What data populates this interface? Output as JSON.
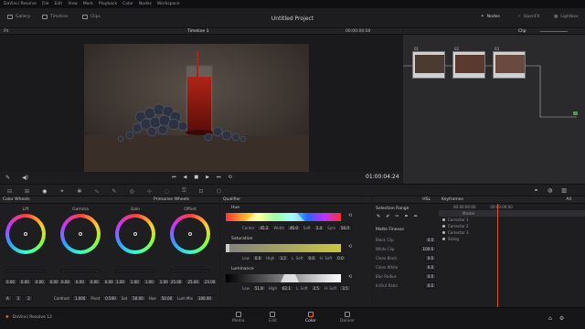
{
  "menu": [
    "DaVinci Resolve",
    "File",
    "Edit",
    "View",
    "Mark",
    "Playback",
    "Color",
    "Nodes",
    "Workspace"
  ],
  "toolbar": {
    "gallery": "Gallery",
    "timeline": "Timeline",
    "clips": "Clips",
    "project_title": "Untitled Project",
    "nodes": "Nodes",
    "openfx": "OpenFX",
    "lightbox": "Lightbox"
  },
  "viewer": {
    "fit": "Fit",
    "timeline_name": "Timeline 1",
    "timecode_top": "00:00:00:00",
    "timecode": "01:00:04:24"
  },
  "node_editor": {
    "mode": "Clip",
    "node_labels": [
      "01",
      "02",
      "03"
    ]
  },
  "wheels": {
    "title": "Color Wheels",
    "mode": "Primaries Wheels",
    "wheels": [
      {
        "label": "Lift",
        "values": [
          "0.00",
          "0.00",
          "0.00",
          "0.00"
        ]
      },
      {
        "label": "Gamma",
        "values": [
          "0.00",
          "0.00",
          "0.00",
          "0.00"
        ]
      },
      {
        "label": "Gain",
        "values": [
          "1.00",
          "1.00",
          "1.00",
          "1.00"
        ]
      },
      {
        "label": "Offset",
        "values": [
          "25.00",
          "25.00",
          "25.00"
        ]
      }
    ],
    "page_a": "A",
    "page_1": "1",
    "page_2": "2",
    "contrast_label": "Contrast",
    "contrast": "1.000",
    "pivot_label": "Pivot",
    "pivot": "0.500",
    "sat_label": "Sat",
    "sat": "50.00",
    "hue_label": "Hue",
    "hue": "50.00",
    "lummix_label": "Lum Mix",
    "lummix": "100.00"
  },
  "qualifier": {
    "title": "Qualifier",
    "hsl": "HSL",
    "hue": {
      "label": "Hue",
      "center_label": "Center",
      "center": "45.2",
      "width_label": "Width",
      "width": "46.0",
      "soft_label": "Soft",
      "soft": "2.4",
      "sym_label": "Sym",
      "sym": "50.0"
    },
    "saturation": {
      "label": "Saturation",
      "low_label": "Low",
      "low": "0.0",
      "high_label": "High",
      "high": "3.2",
      "lsoft_label": "L. Soft",
      "lsoft": "0.0",
      "hsoft_label": "H. Soft",
      "hsoft": "0.0"
    },
    "luminance": {
      "label": "Luminance",
      "low_label": "Low",
      "low": "51.8",
      "high_label": "High",
      "high": "62.1",
      "lsoft_label": "L. Soft",
      "lsoft": "2.5",
      "hsoft_label": "H. Soft",
      "hsoft": "3.5"
    }
  },
  "selection": {
    "title": "Selection Range",
    "finesse": "Matte Finesse",
    "rows": [
      {
        "label": "Black Clip",
        "value": "0.0"
      },
      {
        "label": "White Clip",
        "value": "100.0"
      },
      {
        "label": "Clean Black",
        "value": "0.0"
      },
      {
        "label": "Clean White",
        "value": "0.0"
      },
      {
        "label": "Blur Radius",
        "value": "0.0"
      },
      {
        "label": "In/Out Ratio",
        "value": "0.0"
      }
    ]
  },
  "keyframes": {
    "title": "Keyframes",
    "filter": "All",
    "timecode_a": "00:00:00:00",
    "timecode_b": "00:00:00:00",
    "tracks": [
      "Master",
      "Corrector 1",
      "Corrector 2",
      "Corrector 3",
      "Sizing"
    ]
  },
  "pages": [
    "Media",
    "Edit",
    "Color",
    "Deliver"
  ],
  "app_name": "DaVinci Resolve 12"
}
